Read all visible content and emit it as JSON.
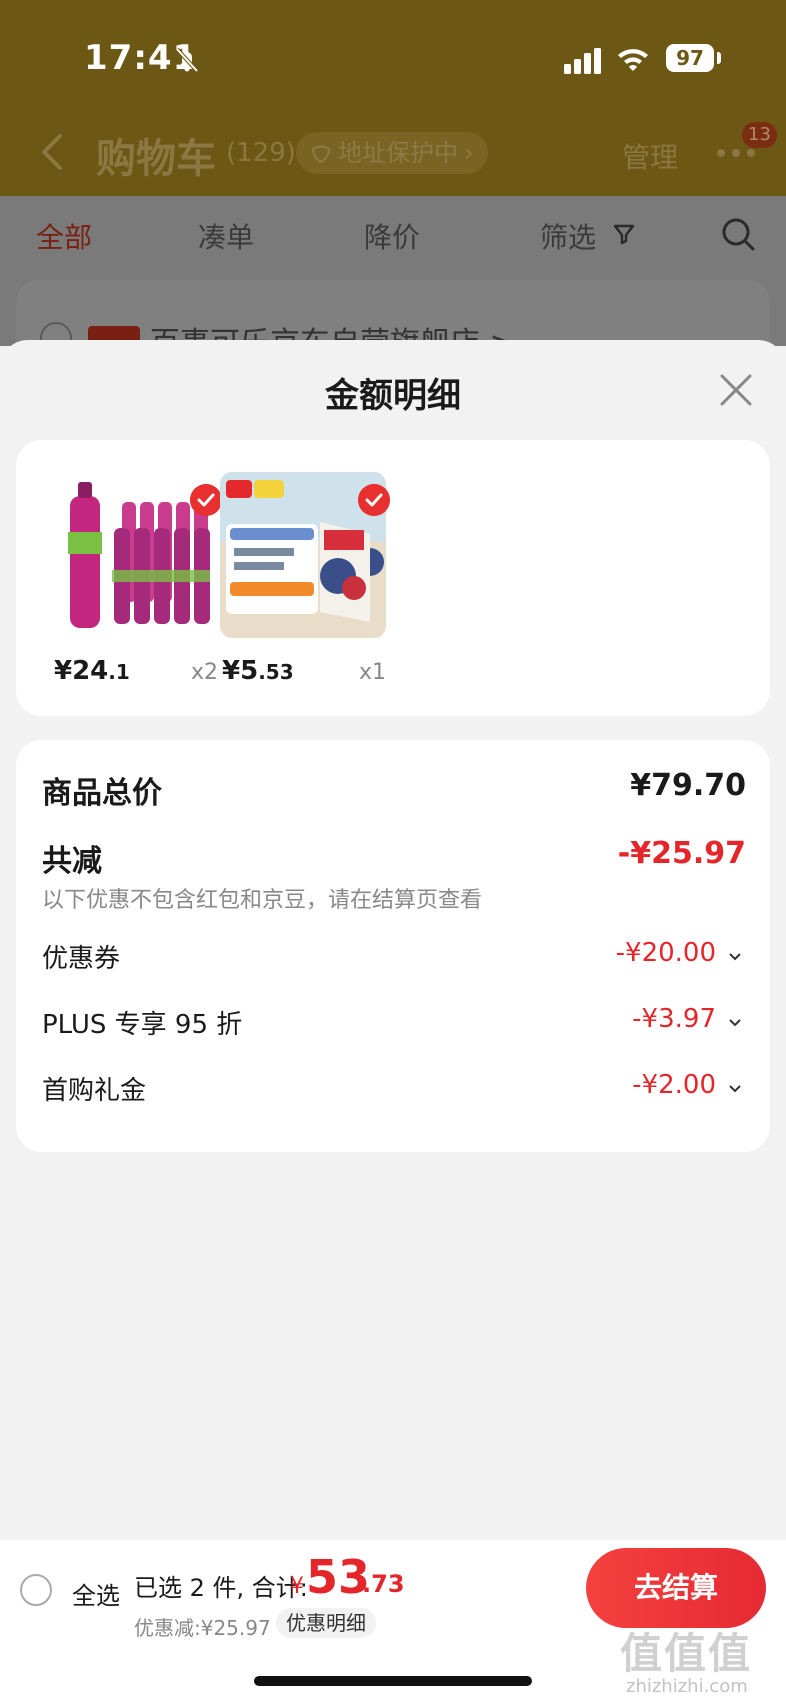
{
  "status_bar": {
    "time": "17:41",
    "battery": "97"
  },
  "nav": {
    "title": "购物车",
    "count": "(129)",
    "address": "地址保护中",
    "manage": "管理",
    "badge": "13"
  },
  "filters": {
    "all": "全部",
    "combine": "凑单",
    "price_drop": "降价",
    "filter": "筛选"
  },
  "background": {
    "store": "百事可乐京东自营旗舰店 >"
  },
  "sheet": {
    "title": "金额明细",
    "products": [
      {
        "price_int": "¥24",
        "price_dec": ".1",
        "qty": "x2"
      },
      {
        "price_int": "¥5",
        "price_dec": ".53",
        "qty": "x1"
      }
    ],
    "total_label": "商品总价",
    "total_value": "¥79.70",
    "discount_label": "共减",
    "discount_value": "-¥25.97",
    "discount_note": "以下优惠不包含红包和京豆，请在结算页查看",
    "items": [
      {
        "label": "优惠券",
        "value": "-¥20.00"
      },
      {
        "label": "PLUS 专享 95 折",
        "value": "-¥3.97"
      },
      {
        "label": "首购礼金",
        "value": "-¥2.00"
      }
    ]
  },
  "bottom": {
    "select_all": "全选",
    "selected_text": "已选 2 件, 合计:",
    "currency": "¥",
    "total_int": "53",
    "total_dec": ".73",
    "discount_text": "优惠减:¥25.97",
    "discount_detail": "优惠明细",
    "checkout": "去结算"
  },
  "watermark": {
    "logo": "值值值",
    "url": "zhizhizhi.com"
  },
  "colors": {
    "accent_red": "#e4262a",
    "nav_bg": "#6d5714"
  }
}
